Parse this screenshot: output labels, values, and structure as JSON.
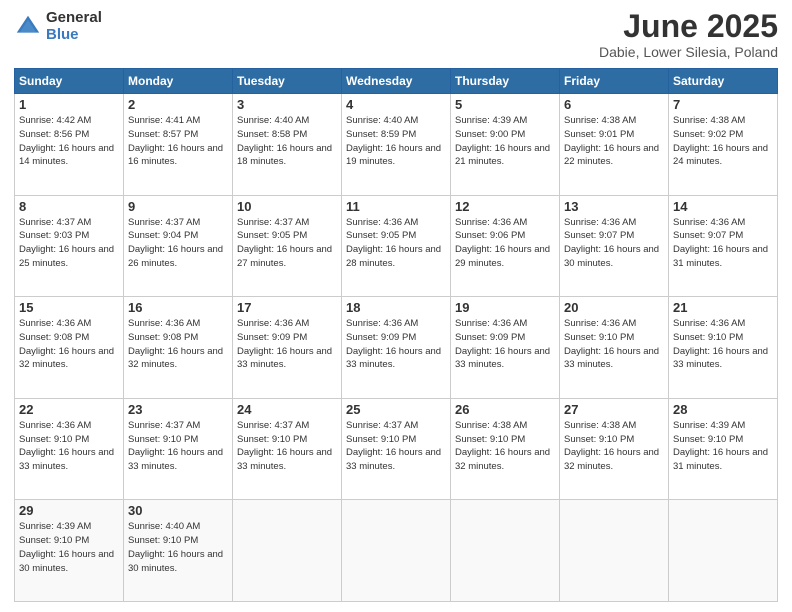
{
  "logo": {
    "general": "General",
    "blue": "Blue"
  },
  "title": "June 2025",
  "location": "Dabie, Lower Silesia, Poland",
  "days_of_week": [
    "Sunday",
    "Monday",
    "Tuesday",
    "Wednesday",
    "Thursday",
    "Friday",
    "Saturday"
  ],
  "weeks": [
    [
      {
        "day": "1",
        "sunrise": "4:42 AM",
        "sunset": "8:56 PM",
        "daylight": "16 hours and 14 minutes."
      },
      {
        "day": "2",
        "sunrise": "4:41 AM",
        "sunset": "8:57 PM",
        "daylight": "16 hours and 16 minutes."
      },
      {
        "day": "3",
        "sunrise": "4:40 AM",
        "sunset": "8:58 PM",
        "daylight": "16 hours and 18 minutes."
      },
      {
        "day": "4",
        "sunrise": "4:40 AM",
        "sunset": "8:59 PM",
        "daylight": "16 hours and 19 minutes."
      },
      {
        "day": "5",
        "sunrise": "4:39 AM",
        "sunset": "9:00 PM",
        "daylight": "16 hours and 21 minutes."
      },
      {
        "day": "6",
        "sunrise": "4:38 AM",
        "sunset": "9:01 PM",
        "daylight": "16 hours and 22 minutes."
      },
      {
        "day": "7",
        "sunrise": "4:38 AM",
        "sunset": "9:02 PM",
        "daylight": "16 hours and 24 minutes."
      }
    ],
    [
      {
        "day": "8",
        "sunrise": "4:37 AM",
        "sunset": "9:03 PM",
        "daylight": "16 hours and 25 minutes."
      },
      {
        "day": "9",
        "sunrise": "4:37 AM",
        "sunset": "9:04 PM",
        "daylight": "16 hours and 26 minutes."
      },
      {
        "day": "10",
        "sunrise": "4:37 AM",
        "sunset": "9:05 PM",
        "daylight": "16 hours and 27 minutes."
      },
      {
        "day": "11",
        "sunrise": "4:36 AM",
        "sunset": "9:05 PM",
        "daylight": "16 hours and 28 minutes."
      },
      {
        "day": "12",
        "sunrise": "4:36 AM",
        "sunset": "9:06 PM",
        "daylight": "16 hours and 29 minutes."
      },
      {
        "day": "13",
        "sunrise": "4:36 AM",
        "sunset": "9:07 PM",
        "daylight": "16 hours and 30 minutes."
      },
      {
        "day": "14",
        "sunrise": "4:36 AM",
        "sunset": "9:07 PM",
        "daylight": "16 hours and 31 minutes."
      }
    ],
    [
      {
        "day": "15",
        "sunrise": "4:36 AM",
        "sunset": "9:08 PM",
        "daylight": "16 hours and 32 minutes."
      },
      {
        "day": "16",
        "sunrise": "4:36 AM",
        "sunset": "9:08 PM",
        "daylight": "16 hours and 32 minutes."
      },
      {
        "day": "17",
        "sunrise": "4:36 AM",
        "sunset": "9:09 PM",
        "daylight": "16 hours and 33 minutes."
      },
      {
        "day": "18",
        "sunrise": "4:36 AM",
        "sunset": "9:09 PM",
        "daylight": "16 hours and 33 minutes."
      },
      {
        "day": "19",
        "sunrise": "4:36 AM",
        "sunset": "9:09 PM",
        "daylight": "16 hours and 33 minutes."
      },
      {
        "day": "20",
        "sunrise": "4:36 AM",
        "sunset": "9:10 PM",
        "daylight": "16 hours and 33 minutes."
      },
      {
        "day": "21",
        "sunrise": "4:36 AM",
        "sunset": "9:10 PM",
        "daylight": "16 hours and 33 minutes."
      }
    ],
    [
      {
        "day": "22",
        "sunrise": "4:36 AM",
        "sunset": "9:10 PM",
        "daylight": "16 hours and 33 minutes."
      },
      {
        "day": "23",
        "sunrise": "4:37 AM",
        "sunset": "9:10 PM",
        "daylight": "16 hours and 33 minutes."
      },
      {
        "day": "24",
        "sunrise": "4:37 AM",
        "sunset": "9:10 PM",
        "daylight": "16 hours and 33 minutes."
      },
      {
        "day": "25",
        "sunrise": "4:37 AM",
        "sunset": "9:10 PM",
        "daylight": "16 hours and 33 minutes."
      },
      {
        "day": "26",
        "sunrise": "4:38 AM",
        "sunset": "9:10 PM",
        "daylight": "16 hours and 32 minutes."
      },
      {
        "day": "27",
        "sunrise": "4:38 AM",
        "sunset": "9:10 PM",
        "daylight": "16 hours and 32 minutes."
      },
      {
        "day": "28",
        "sunrise": "4:39 AM",
        "sunset": "9:10 PM",
        "daylight": "16 hours and 31 minutes."
      }
    ],
    [
      {
        "day": "29",
        "sunrise": "4:39 AM",
        "sunset": "9:10 PM",
        "daylight": "16 hours and 30 minutes."
      },
      {
        "day": "30",
        "sunrise": "4:40 AM",
        "sunset": "9:10 PM",
        "daylight": "16 hours and 30 minutes."
      },
      null,
      null,
      null,
      null,
      null
    ]
  ]
}
